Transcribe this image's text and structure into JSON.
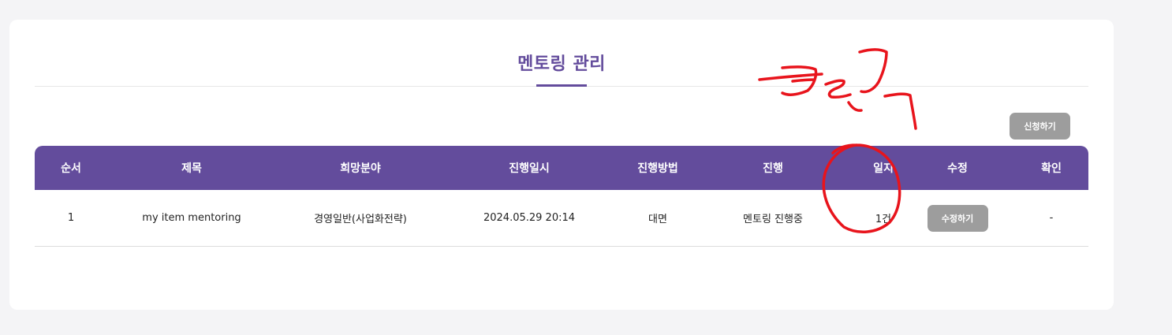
{
  "page": {
    "title": "멘토링 관리",
    "apply_button_label": "신청하기"
  },
  "table": {
    "headers": [
      "순서",
      "제목",
      "희망분야",
      "진행일시",
      "진행방법",
      "진행",
      "일지",
      "수정",
      "확인"
    ],
    "rows": [
      {
        "order": "1",
        "title": "my item mentoring",
        "field": "경영일반(사업화전략)",
        "datetime": "2024.05.29 20:14",
        "method": "대면",
        "status": "멘토링 진행중",
        "journal": "1건",
        "edit_label": "수정하기",
        "confirm": "-"
      }
    ]
  },
  "colors": {
    "accent": "#634c9c",
    "button_gray": "#9d9d9d",
    "annotation_red": "#e8141c"
  },
  "annotation": {
    "handwritten_text": "클릭"
  }
}
